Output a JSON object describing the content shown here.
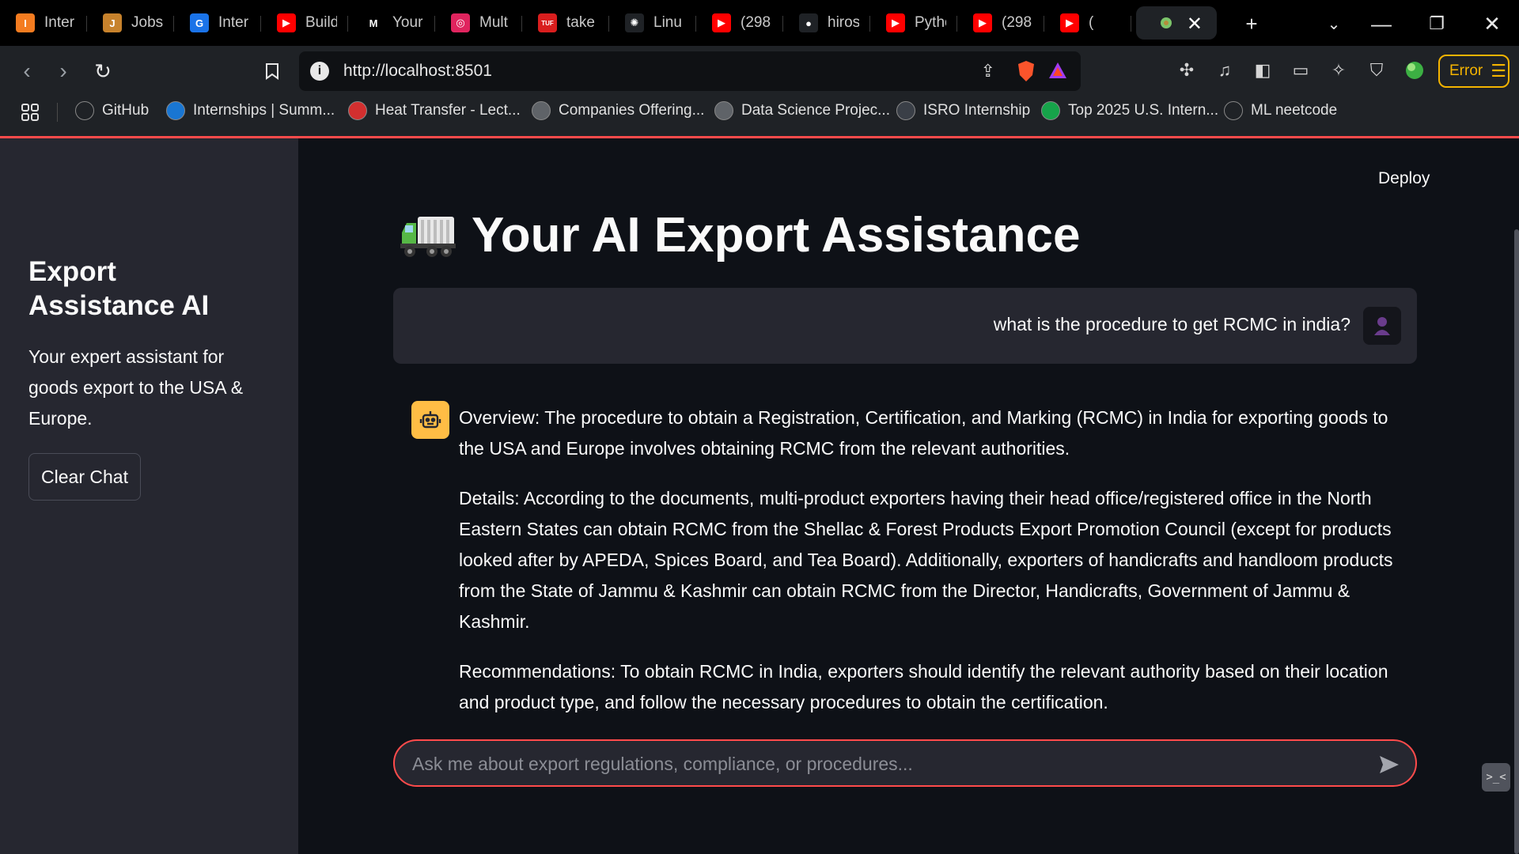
{
  "browser": {
    "tabs": [
      {
        "title": "Inter",
        "icon": "internshala-icon",
        "color": "#f47c20",
        "glyph": "I"
      },
      {
        "title": "Jobs",
        "icon": "jobs-icon",
        "color": "#c7822c",
        "glyph": "J"
      },
      {
        "title": "Inter",
        "icon": "globe-icon",
        "color": "#1a73e8",
        "glyph": "G"
      },
      {
        "title": "Build",
        "icon": "youtube-icon",
        "color": "#ff0000",
        "glyph": "▶"
      },
      {
        "title": "Your",
        "icon": "medium-icon",
        "color": "#000000",
        "glyph": "M"
      },
      {
        "title": "Mult",
        "icon": "target-icon",
        "color": "#e0245e",
        "glyph": "◎"
      },
      {
        "title": "take",
        "icon": "tuf-icon",
        "color": "#d91e1e",
        "glyph": "TUF"
      },
      {
        "title": "Linu",
        "icon": "openai-icon",
        "color": "#1f2226",
        "glyph": "✺"
      },
      {
        "title": "(298",
        "icon": "youtube-icon",
        "color": "#ff0000",
        "glyph": "▶"
      },
      {
        "title": "hiros",
        "icon": "github-icon",
        "color": "#1f2226",
        "glyph": "●"
      },
      {
        "title": "Pytho",
        "icon": "youtube-icon",
        "color": "#ff0000",
        "glyph": "▶"
      },
      {
        "title": "(298",
        "icon": "youtube-icon",
        "color": "#ff0000",
        "glyph": "▶"
      },
      {
        "title": "(",
        "icon": "youtube-audio-icon",
        "color": "#ff0000",
        "glyph": "▶"
      }
    ],
    "active_tab": {
      "title": "",
      "icon": "streamlit-icon"
    },
    "url": "http://localhost:8501",
    "error_label": "Error",
    "bookmarks": [
      {
        "label": "GitHub",
        "icon": "github-icon",
        "color": "#1f2226"
      },
      {
        "label": "Internships | Summ...",
        "icon": "internshipsafari-icon",
        "color": "#1976d2"
      },
      {
        "label": "Heat Transfer - Lect...",
        "icon": "nptel-icon",
        "color": "#d32f2f"
      },
      {
        "label": "Companies Offering...",
        "icon": "t-icon",
        "color": "#5f6368"
      },
      {
        "label": "Data Science Projec...",
        "icon": "t-icon",
        "color": "#5f6368"
      },
      {
        "label": "ISRO Internship",
        "icon": "isro-icon",
        "color": "#3a3f47"
      },
      {
        "label": "Top 2025 U.S. Intern...",
        "icon": "i-icon",
        "color": "#16a34a"
      },
      {
        "label": "ML neetcode",
        "icon": "rocket-icon",
        "color": "#1f2226"
      }
    ]
  },
  "app": {
    "deploy_label": "Deploy",
    "sidebar": {
      "title": "Export Assistance AI",
      "description": "Your expert assistant for goods export to the USA & Europe.",
      "clear_button": "Clear Chat"
    },
    "page_title": "Your AI Export Assistance",
    "messages": {
      "user": "what is the procedure to get RCMC in india?",
      "assistant": [
        "Overview: The procedure to obtain a Registration, Certification, and Marking (RCMC) in India for exporting goods to the USA and Europe involves obtaining RCMC from the relevant authorities.",
        "Details: According to the documents, multi-product exporters having their head office/registered office in the North Eastern States can obtain RCMC from the Shellac & Forest Products Export Promotion Council (except for products looked after by APEDA, Spices Board, and Tea Board). Additionally, exporters of handicrafts and handloom products from the State of Jammu & Kashmir can obtain RCMC from the Director, Handicrafts, Government of Jammu & Kashmir.",
        "Recommendations: To obtain RCMC in India, exporters should identify the relevant authority based on their location and product type, and follow the necessary procedures to obtain the certification."
      ]
    },
    "chat_input": {
      "placeholder": "Ask me about export regulations, compliance, or procedures..."
    },
    "colors": {
      "accent": "#ff4b4b",
      "bot_avatar": "#ffbd45",
      "sidebar_bg": "#262730",
      "main_bg": "#0e1117"
    }
  }
}
